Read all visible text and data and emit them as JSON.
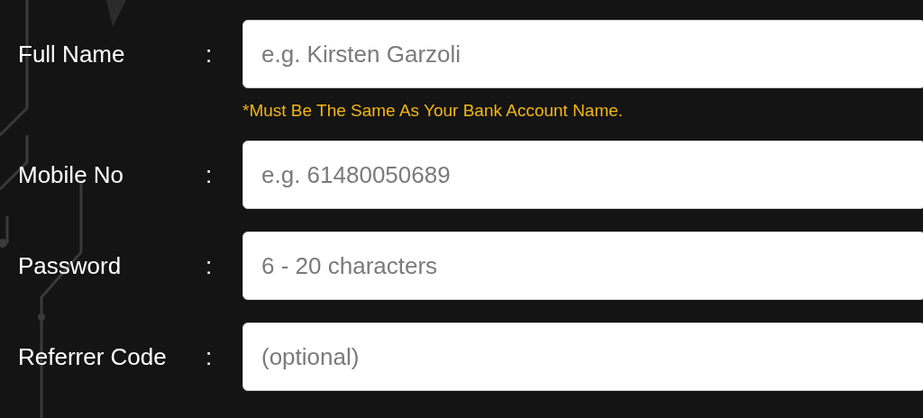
{
  "form": {
    "fields": [
      {
        "label": "Full Name",
        "separator": ":",
        "placeholder": "e.g. Kirsten Garzoli",
        "note": "*Must Be The Same As Your Bank Account Name."
      },
      {
        "label": "Mobile No",
        "separator": ":",
        "placeholder": "e.g. 61480050689"
      },
      {
        "label": "Password",
        "separator": ":",
        "placeholder": "6 - 20 characters"
      },
      {
        "label": "Referrer Code",
        "separator": ":",
        "placeholder": "(optional)"
      }
    ]
  }
}
